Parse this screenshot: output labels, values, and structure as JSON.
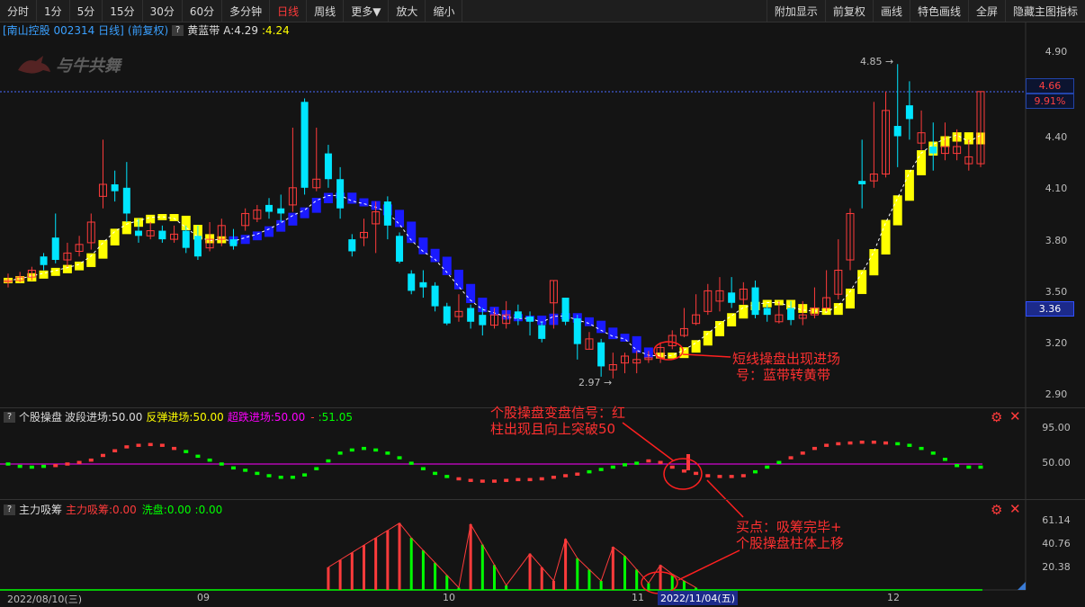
{
  "toolbar": {
    "left_items": [
      "分时",
      "1分",
      "5分",
      "15分",
      "30分",
      "60分",
      "多分钟",
      "日线",
      "周线",
      "更多▼",
      "放大",
      "缩小"
    ],
    "active": "日线",
    "right_items": [
      "附加显示",
      "前复权",
      "画线",
      "特色画线",
      "全屏",
      "隐藏主图指标"
    ]
  },
  "main": {
    "title": "[南山控股 002314 日线]",
    "adj": "(前复权)",
    "indicator_name": "黄蓝带",
    "a_value": "A:4.29",
    "b_value": ":4.24",
    "watermark": "与牛共舞",
    "axis_labels": [
      "4.90",
      "4.40",
      "4.10",
      "3.80",
      "3.50",
      "3.20",
      "2.90"
    ],
    "high_label": "4.85",
    "low_label": "2.97",
    "price_tag": "4.66",
    "pct_tag": "9.91%",
    "price_tag2": "3.36"
  },
  "panel2": {
    "name": "个股操盘",
    "l1": "波段进场:50.00",
    "l2": "反弹进场:50.00",
    "l3": "超跌进场:50.00",
    "l4": ":51.05",
    "dash": "-",
    "axis_labels": [
      "95.00",
      "50.00"
    ]
  },
  "panel3": {
    "name": "主力吸筹",
    "l1": "主力吸筹:0.00",
    "l2": "洗盘:0.00",
    "l3": ":0.00",
    "axis_labels": [
      "61.14",
      "40.76",
      "20.38"
    ]
  },
  "dates": {
    "start": "2022/08/10(三)",
    "m9": "09",
    "m10": "10",
    "m11": "11",
    "cursor": "2022/11/04(五)",
    "m12": "12"
  },
  "annotations": {
    "a1": [
      "短线操盘出现进场",
      "号：蓝带转黄带"
    ],
    "a2": [
      "个股操盘变盘信号：红",
      "柱出现且向上突破50"
    ],
    "a3": [
      "买点：吸筹完毕+",
      "个股操盘柱体上移"
    ]
  },
  "colors": {
    "up": "#ff3b3b",
    "down": "#00e5ff",
    "yellow": "#ffff00",
    "blue": "#1a1aff",
    "green": "#00ff00",
    "magenta": "#ff00ff"
  }
}
